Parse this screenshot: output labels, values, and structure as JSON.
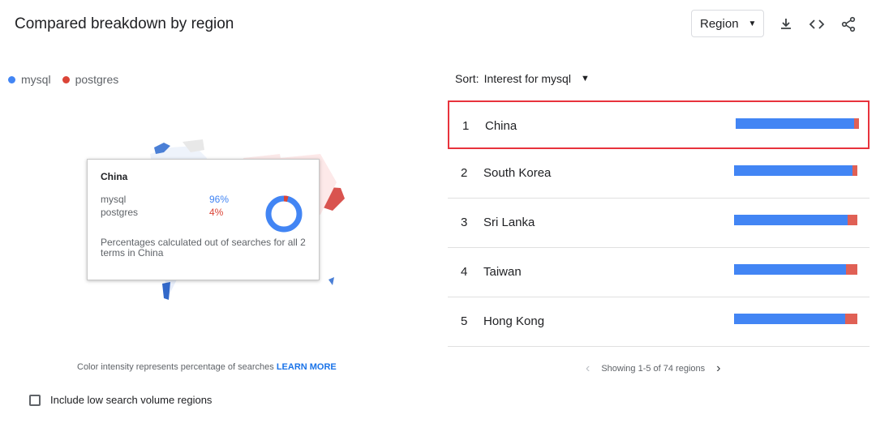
{
  "header": {
    "title": "Compared breakdown by region",
    "region_select": "Region",
    "icons": [
      "download-icon",
      "embed-code-icon",
      "share-icon"
    ]
  },
  "legend": [
    {
      "label": "mysql",
      "color": "#4285f4"
    },
    {
      "label": "postgres",
      "color": "#db4437"
    }
  ],
  "tooltip": {
    "title": "China",
    "rows": [
      {
        "term": "mysql",
        "pct": "96%",
        "color": "#4285f4",
        "value": 96
      },
      {
        "term": "postgres",
        "pct": "4%",
        "color": "#db4437",
        "value": 4
      }
    ],
    "note": "Percentages calculated out of searches for all 2 terms in China"
  },
  "map_caption": {
    "text": "Color intensity represents percentage of searches",
    "link": "LEARN MORE"
  },
  "checkbox_label": "Include low search volume regions",
  "sort": {
    "label": "Sort:",
    "value": "Interest for mysql"
  },
  "ranking": [
    {
      "rank": "1",
      "name": "China",
      "mysql": 96,
      "postgres": 4
    },
    {
      "rank": "2",
      "name": "South Korea",
      "mysql": 96,
      "postgres": 4
    },
    {
      "rank": "3",
      "name": "Sri Lanka",
      "mysql": 92,
      "postgres": 8
    },
    {
      "rank": "4",
      "name": "Taiwan",
      "mysql": 91,
      "postgres": 9
    },
    {
      "rank": "5",
      "name": "Hong Kong",
      "mysql": 90,
      "postgres": 10
    }
  ],
  "pager": {
    "text": "Showing 1-5 of 74 regions"
  }
}
